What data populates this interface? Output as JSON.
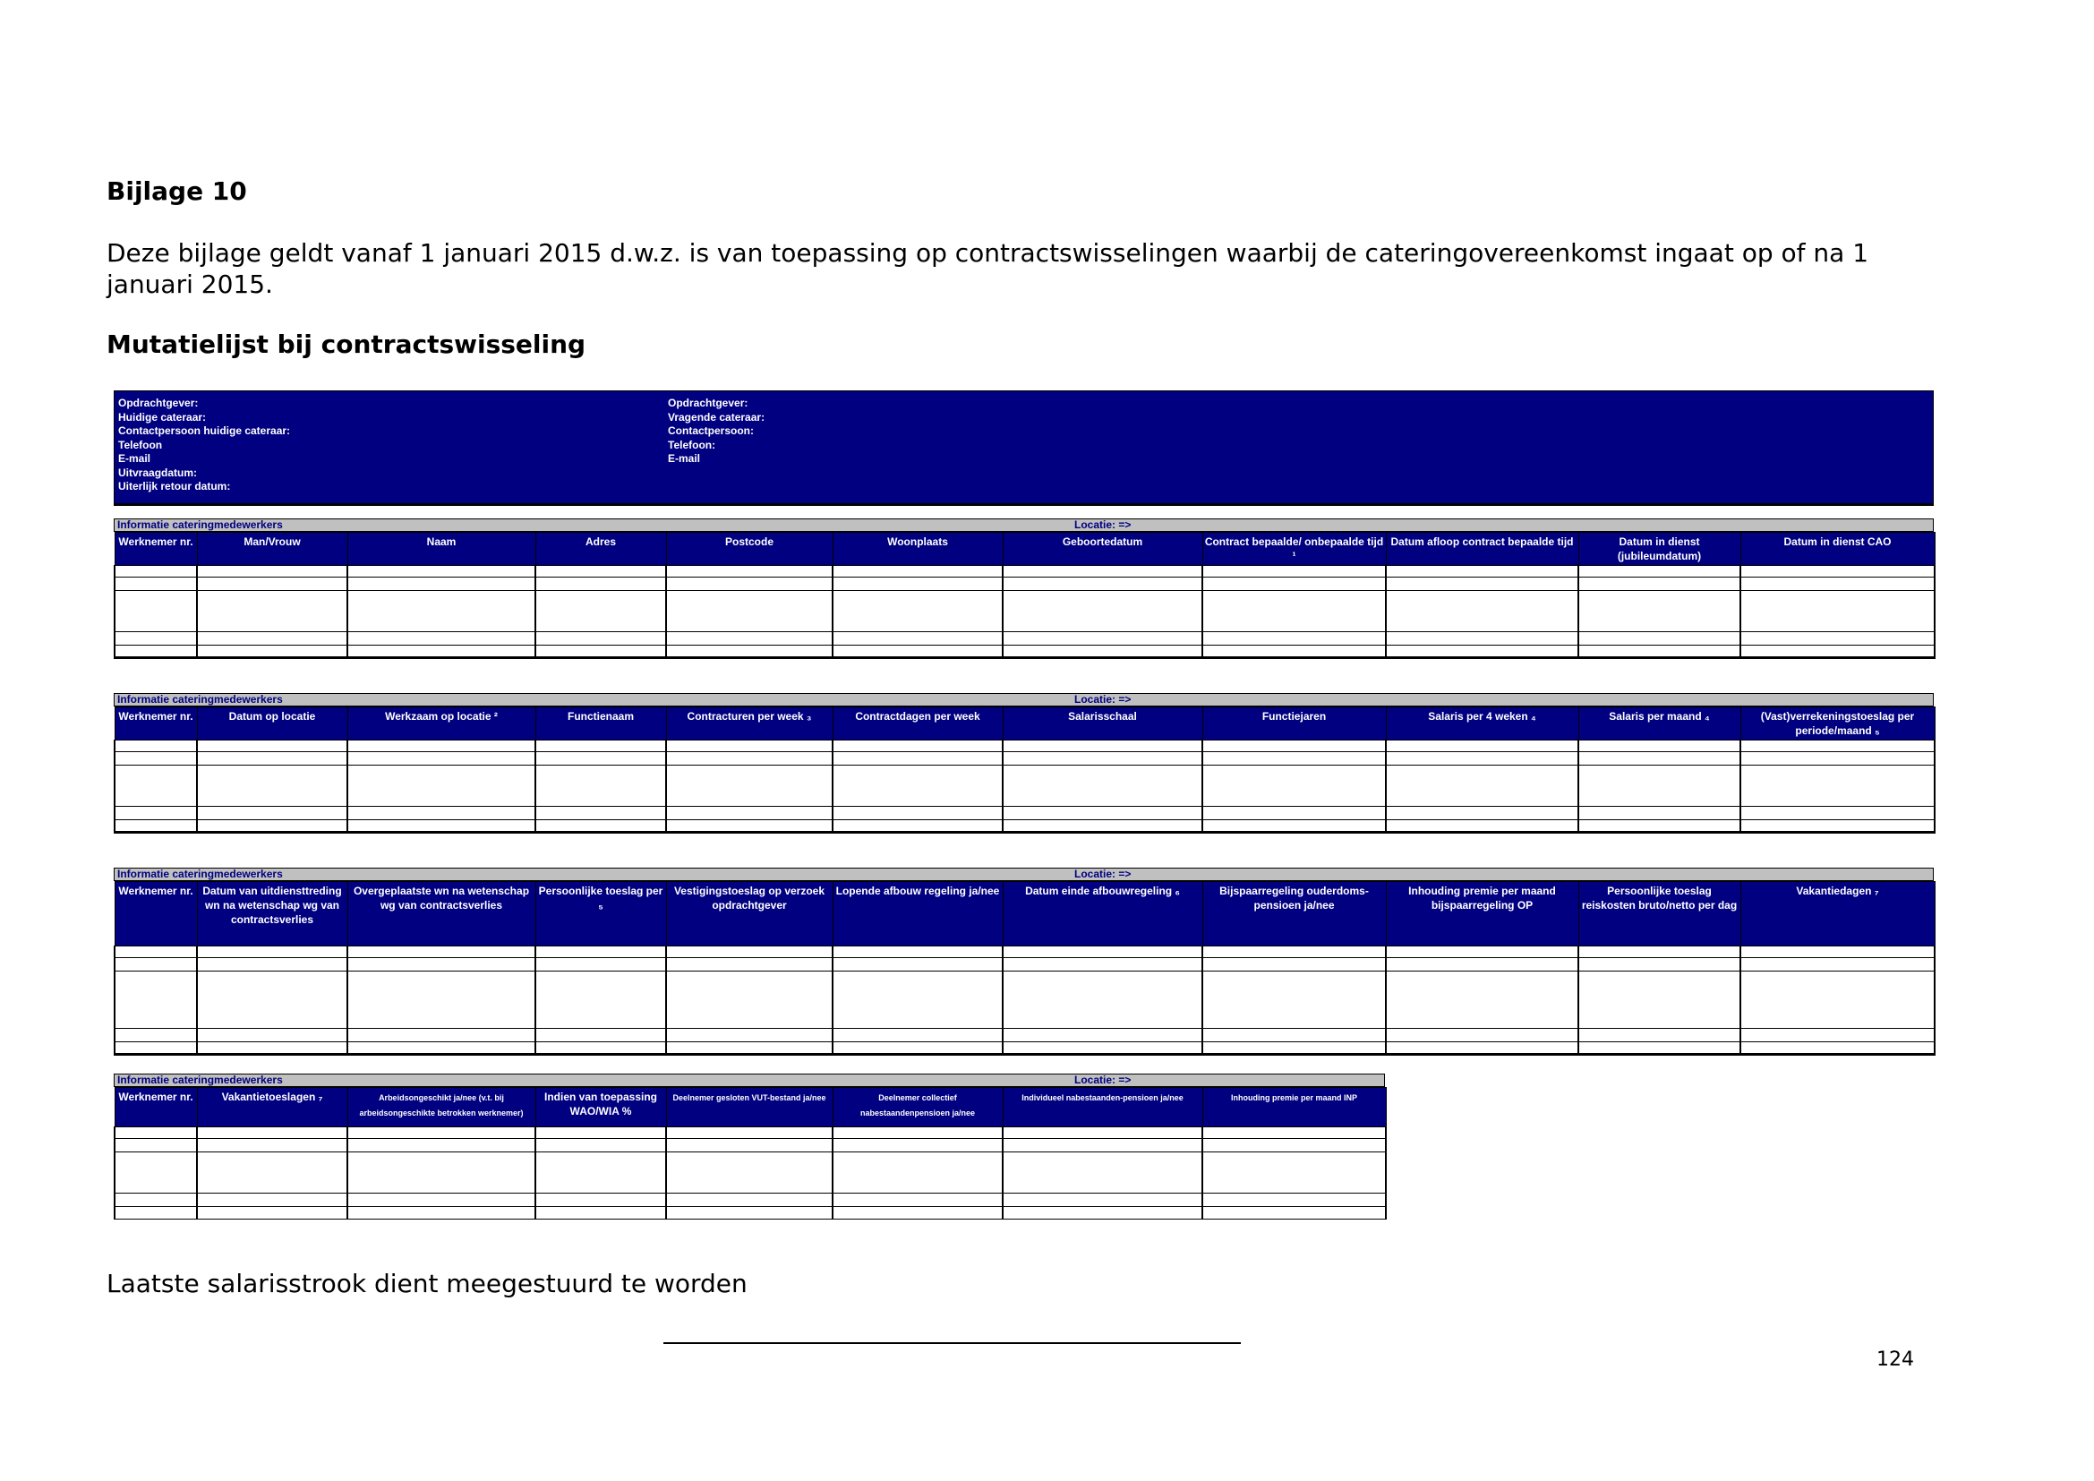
{
  "page": {
    "title": "Bijlage 10",
    "intro": "Deze bijlage geldt vanaf 1 januari 2015 d.w.z. is van toepassing op contractswisselingen waarbij de cateringovereenkomst ingaat op of na 1 januari 2015.",
    "subtitle": "Mutatielijst bij contractswisseling",
    "footer_note": "Laatste salarisstrook dient meegestuurd te worden",
    "page_number": "124"
  },
  "header_box": {
    "left": [
      "Opdrachtgever:",
      "Huidige cateraar:",
      "Contactpersoon huidige cateraar:",
      "Telefoon",
      "E-mail",
      "Uitvraagdatum:",
      "Uiterlijk retour datum:"
    ],
    "right": [
      "Opdrachtgever:",
      "Vragende cateraar:",
      "Contactpersoon:",
      "Telefoon:",
      "E-mail"
    ]
  },
  "sections": [
    {
      "bar_left": "Informatie cateringmedewerkers",
      "bar_right": "Locatie: =>",
      "columns": [
        "Werknemer nr.",
        "Man/Vrouw",
        "Naam",
        "Adres",
        "Postcode",
        "Woonplaats",
        "Geboortedatum",
        "Contract bepaalde/ onbepaalde tijd ¹",
        "Datum afloop contract bepaalde tijd",
        "Datum in dienst (jubileumdatum)",
        "Datum in dienst CAO"
      ]
    },
    {
      "bar_left": "Informatie cateringmedewerkers",
      "bar_right": "Locatie: =>",
      "columns": [
        "Werknemer nr.",
        "Datum op locatie",
        "Werkzaam op locatie ²",
        "Functienaam",
        "Contracturen per week ₃",
        "Contractdagen per week",
        "Salarisschaal",
        "Functiejaren",
        "Salaris per 4 weken ₄",
        "Salaris per maand ₄",
        "(Vast)verrekeningstoeslag per periode/maand ₅"
      ]
    },
    {
      "bar_left": "Informatie cateringmedewerkers",
      "bar_right": "Locatie: =>",
      "columns": [
        "Werknemer nr.",
        "Datum van uitdiensttreding wn na wetenschap wg van contractsverlies",
        "Overgeplaatste wn na wetenschap wg van contractsverlies",
        "Persoonlijke toeslag per ₅",
        "Vestigingstoeslag op verzoek opdrachtgever",
        "Lopende afbouw regeling ja/nee",
        "Datum einde afbouwregeling ₆",
        "Bijspaarregeling ouderdoms-pensioen ja/nee",
        "Inhouding premie per maand bijspaarregeling OP",
        "Persoonlijke toeslag reiskosten bruto/netto per dag",
        "Vakantiedagen ₇"
      ]
    },
    {
      "bar_left": "Informatie cateringmedewerkers",
      "bar_right": "Locatie: =>",
      "columns": [
        "Werknemer nr.",
        "Vakantietoeslagen ₇",
        "Arbeidsongeschikt ja/nee (v.t. bij arbeidsongeschikte betrokken werknemer)",
        "Indien van toepassing WAO/WIA %",
        "Deelnemer gesloten VUT-bestand ja/nee",
        "Deelnemer collectief nabestaandenpensioen ja/nee",
        "Individueel nabestaanden-pensioen ja/nee",
        "Inhouding premie per maand INP"
      ]
    }
  ]
}
